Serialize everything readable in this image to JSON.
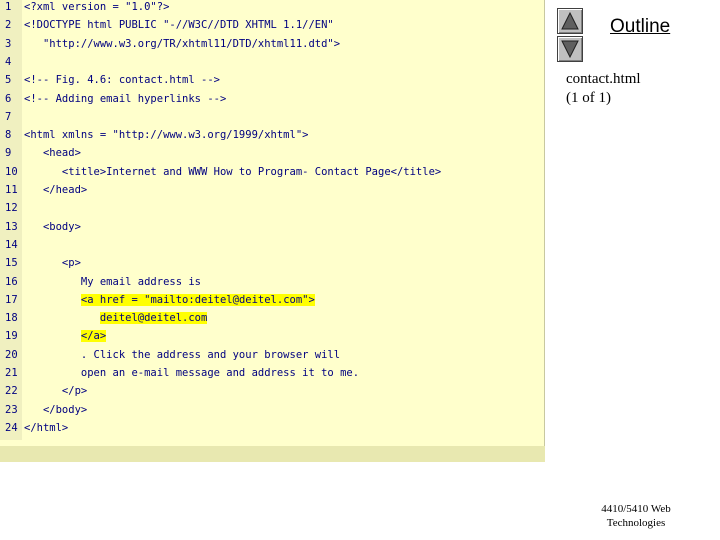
{
  "code": {
    "lines": [
      {
        "n": "1",
        "parts": [
          "<?xml version = \"1.0\"?>"
        ]
      },
      {
        "n": "2",
        "parts": [
          "<!DOCTYPE html PUBLIC \"-//W3C//DTD XHTML 1.1//EN\""
        ]
      },
      {
        "n": "3",
        "parts": [
          "   \"http://www.w3.org/TR/xhtml11/DTD/xhtml11.dtd\">"
        ]
      },
      {
        "n": "4",
        "parts": [
          ""
        ]
      },
      {
        "n": "5",
        "parts": [
          "<!-- Fig. 4.6: contact.html -->"
        ]
      },
      {
        "n": "6",
        "parts": [
          "<!-- Adding email hyperlinks -->"
        ]
      },
      {
        "n": "7",
        "parts": [
          ""
        ]
      },
      {
        "n": "8",
        "parts": [
          "<html xmlns = \"http://www.w3.org/1999/xhtml\">"
        ]
      },
      {
        "n": "9",
        "parts": [
          "   <head>"
        ]
      },
      {
        "n": "10",
        "parts": [
          "      <title>Internet and WWW How to Program- Contact Page</title>"
        ]
      },
      {
        "n": "11",
        "parts": [
          "   </head>"
        ]
      },
      {
        "n": "12",
        "parts": [
          ""
        ]
      },
      {
        "n": "13",
        "parts": [
          "   <body>"
        ]
      },
      {
        "n": "14",
        "parts": [
          ""
        ]
      },
      {
        "n": "15",
        "parts": [
          "      <p>"
        ]
      },
      {
        "n": "16",
        "parts": [
          "         My email address is"
        ]
      },
      {
        "n": "17",
        "pre": "         ",
        "hl": "<a href = \"mailto:deitel@deitel.com\">"
      },
      {
        "n": "18",
        "pre": "            ",
        "hl": "deitel@deitel.com"
      },
      {
        "n": "19",
        "pre": "         ",
        "hl": "</a>"
      },
      {
        "n": "20",
        "parts": [
          "         . Click the address and your browser will"
        ]
      },
      {
        "n": "21",
        "parts": [
          "         open an e-mail message and address it to me."
        ]
      },
      {
        "n": "22",
        "parts": [
          "      </p>"
        ]
      },
      {
        "n": "23",
        "parts": [
          "   </body>"
        ]
      },
      {
        "n": "24",
        "parts": [
          "</html>"
        ]
      }
    ]
  },
  "sidebar": {
    "outline_label": "Outline",
    "up_icon": "triangle-up-icon",
    "down_icon": "triangle-down-icon",
    "file_name": "contact.html",
    "page_info": "(1 of 1)"
  },
  "footer": {
    "line1": "4410/5410 Web",
    "line2": "Technologies"
  },
  "colors": {
    "code_bg": "#ffffcc",
    "code_text": "#000080",
    "highlight": "#ffff00"
  }
}
